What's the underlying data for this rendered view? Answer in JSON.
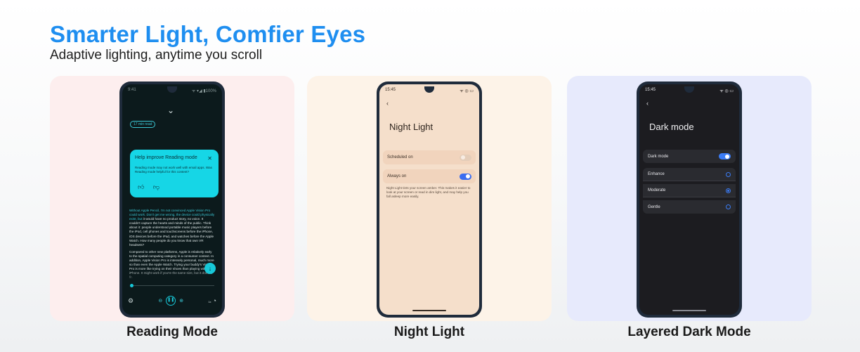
{
  "header": {
    "title": "Smarter Light, Comfier Eyes",
    "subtitle": "Adaptive lighting, anytime you scroll"
  },
  "colors": {
    "title_accent": "#1e8ef0",
    "reading_card_bg": "#fdeeee",
    "night_card_bg": "#fdf3e8",
    "dark_card_bg": "#e7eafc",
    "reading_accent": "#17c8d8",
    "toggle_on": "#3a6cf0"
  },
  "panels": [
    {
      "caption": "Reading Mode",
      "status": {
        "time": "9:41",
        "icons": "ᯤ ▾◢ ▮100%"
      },
      "collapse_icon": "chevron-down-icon",
      "read_time": "17 min read",
      "popup": {
        "title": "Help improve Reading mode",
        "body": "Reading mode may not work well with email apps. Was Reading mode helpful for this content?",
        "close_icon": "close-icon",
        "thumbs_up_icon": "thumbs-up-icon",
        "thumbs_down_icon": "thumbs-down-icon"
      },
      "article": {
        "p1_highlight": "Without Apple Pencil, I'm not convinced Apple Vision Pro could work. Don't get me wrong, the device could physically exist, but",
        "p1_rest": " it would have no product story, no voice. It couldn't capture the hearts and minds of the public. Think about it: people understood portable music players before the iPod, cell phones and touchscreens before the iPhone, iOS devices before the iPad, and watches before the Apple Watch. How many people do you know that own VR headsets?",
        "p2": "Compared to other new platforms, Apple is relatively early to the spatial computing category in a consumer context. In addition, Apple Vision Pro is intensely personal, much more so than even the Apple Watch. Trying your buddy's Vision Pro is more like trying on their shoes than playing with their iPhone. It might work if you're the same size, but it doesn't fit."
      },
      "player": {
        "progress": 0.02,
        "settings_icon": "gear-icon",
        "rewind_icon": "rewind-icon",
        "pause_icon": "pause-icon",
        "forward_icon": "forward-icon",
        "speed_prefix": "1x",
        "speed_icon": "speed-gauge-icon",
        "scroll_icon": "arrow-down-icon"
      }
    },
    {
      "caption": "Night Light",
      "status": {
        "time": "15:45",
        "icons": "ᯤ ◎ ▭"
      },
      "back_icon": "back-arrow-icon",
      "page_title": "Night Light",
      "settings": [
        {
          "label": "Scheduled on",
          "on": false
        },
        {
          "label": "Always on",
          "on": true
        }
      ],
      "description": "Night Light tints your screen amber. This makes it easier to look at your screen or read in dim light, and may help you fall asleep more easily."
    },
    {
      "caption": "Layered Dark Mode",
      "status": {
        "time": "15:45",
        "icons": "ᯤ ◎ ▭"
      },
      "back_icon": "back-arrow-icon",
      "page_title": "Dark mode",
      "toggle": {
        "label": "Dark mode",
        "on": true
      },
      "options": [
        {
          "label": "Enhance",
          "selected": false
        },
        {
          "label": "Moderate",
          "selected": true
        },
        {
          "label": "Gentle",
          "selected": false
        }
      ]
    }
  ]
}
